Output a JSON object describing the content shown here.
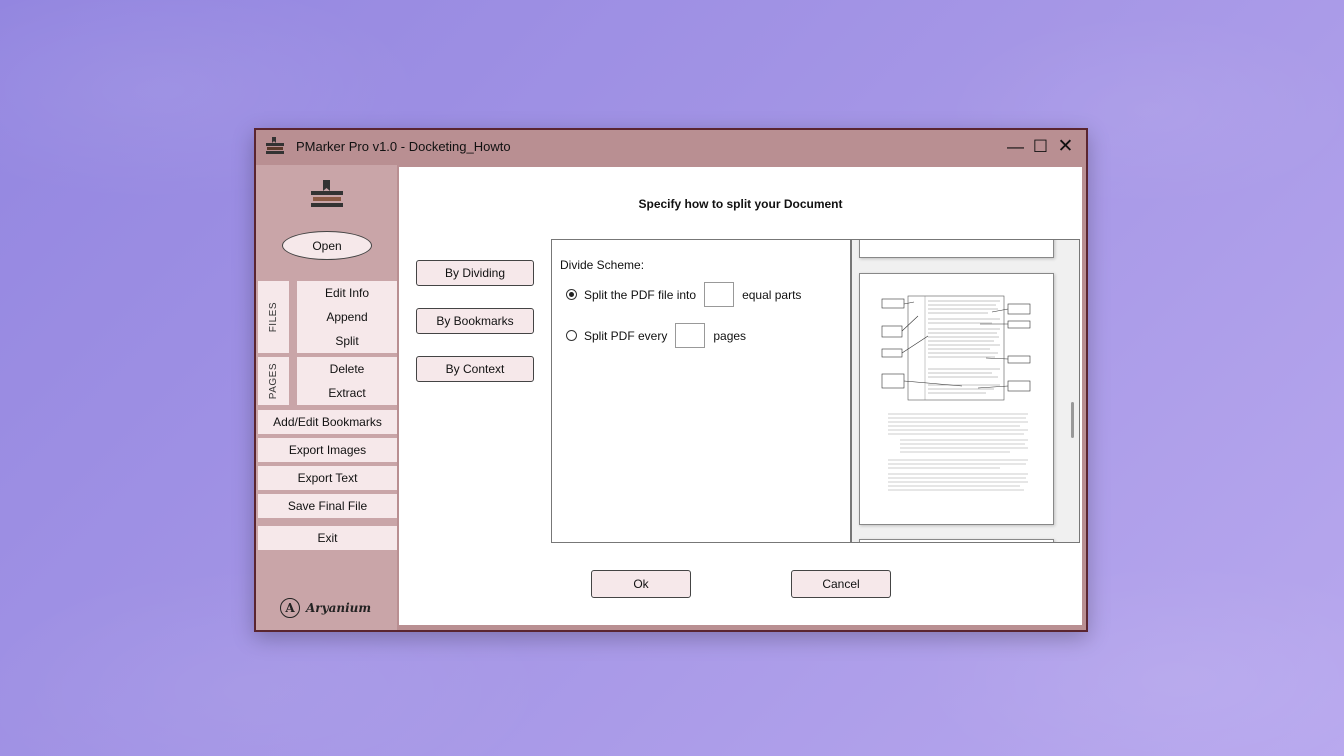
{
  "window": {
    "title": "PMarker Pro v1.0 - Docketing_Howto"
  },
  "sidebar": {
    "open_label": "Open",
    "files_tab": "FILES",
    "files_items": [
      "Edit Info",
      "Append",
      "Split"
    ],
    "pages_tab": "PAGES",
    "pages_items": [
      "Delete",
      "Extract"
    ],
    "actions": [
      "Add/Edit Bookmarks",
      "Export Images",
      "Export Text",
      "Save Final File"
    ],
    "exit_label": "Exit",
    "brand_mark": "A",
    "brand_name": "Aryanium"
  },
  "dialog": {
    "title": "Specify how to split your Document",
    "methods": [
      "By Dividing",
      "By Bookmarks",
      "By Context"
    ],
    "scheme_label": "Divide Scheme:",
    "option1": {
      "prefix": "Split the PDF file into",
      "suffix": "equal parts",
      "value": "",
      "selected": true
    },
    "option2": {
      "prefix": "Split PDF every",
      "suffix": "pages",
      "value": "",
      "selected": false
    },
    "ok_label": "Ok",
    "cancel_label": "Cancel"
  },
  "icons": {
    "app": "books-stack-icon",
    "logo": "books-stack-icon",
    "minimize": "minimize-icon",
    "maximize": "maximize-icon",
    "close": "close-icon"
  },
  "colors": {
    "window_frame": "#b98f92",
    "sidebar": "#c9a5a8",
    "button_fill": "#f6e8ea",
    "border_dark": "#5a2530"
  }
}
